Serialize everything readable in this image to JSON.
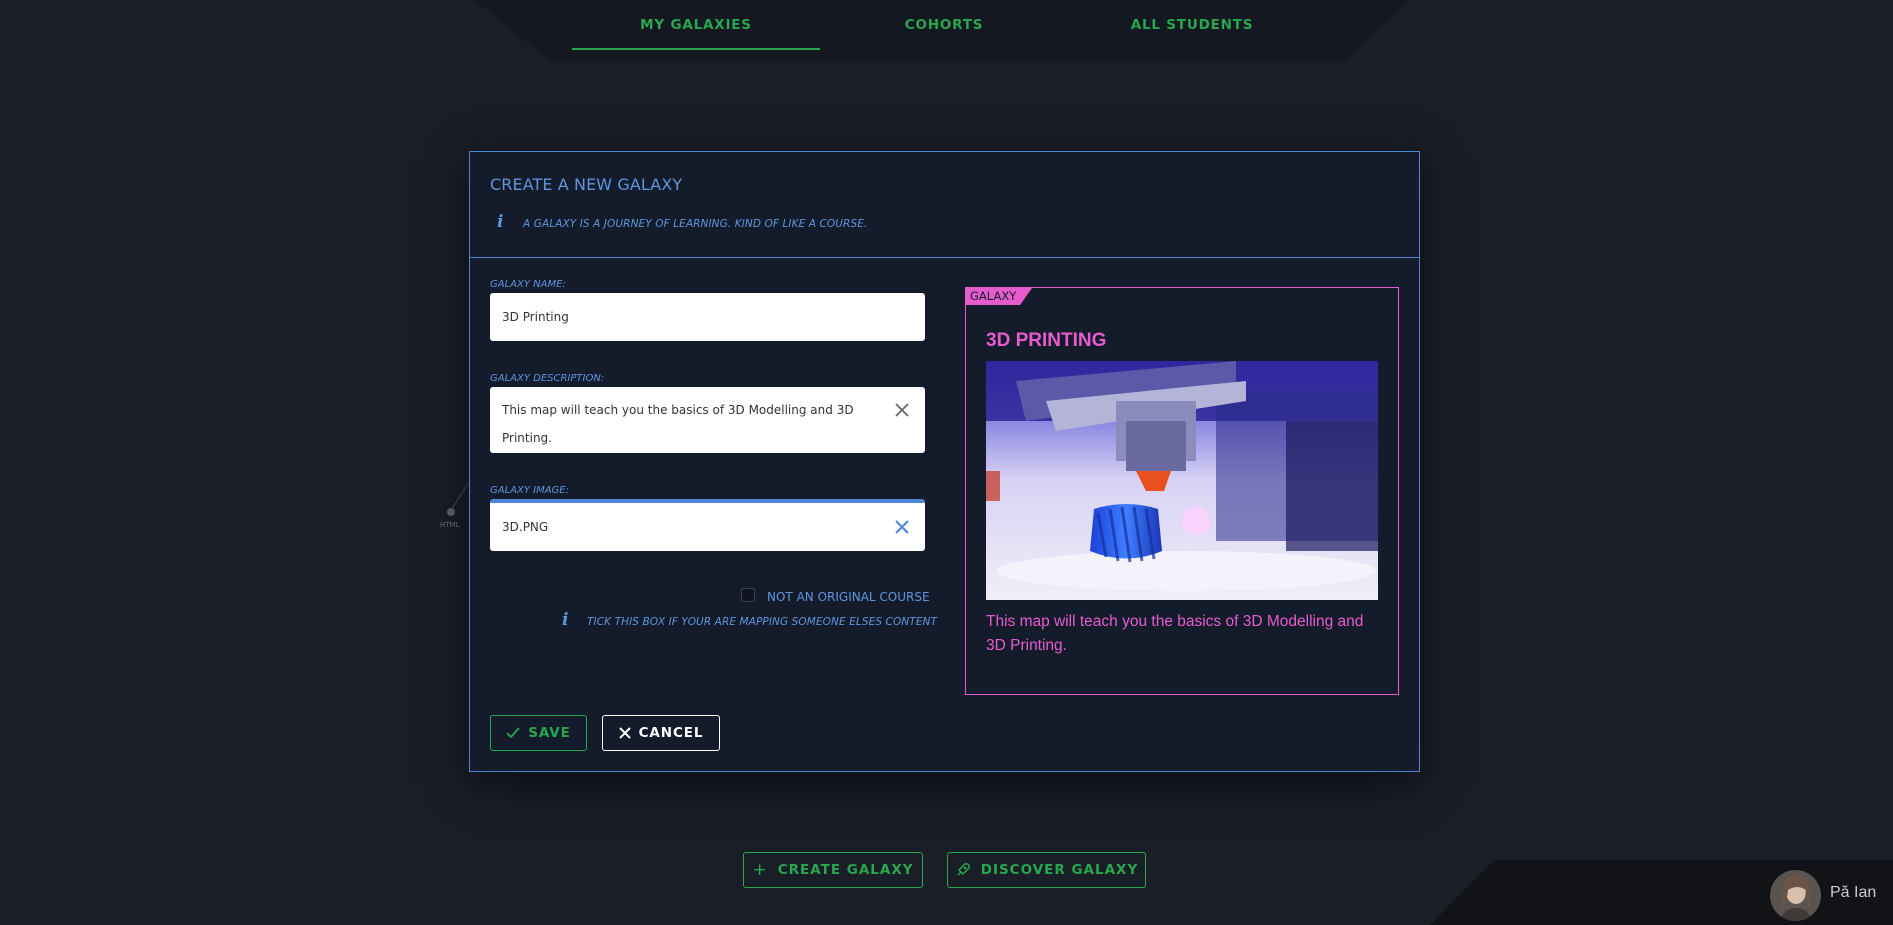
{
  "nav": {
    "tabs": [
      {
        "label": "MY GALAXIES",
        "active": true
      },
      {
        "label": "COHORTS",
        "active": false
      },
      {
        "label": "ALL STUDENTS",
        "active": false
      }
    ]
  },
  "background_node": {
    "label": "HTML"
  },
  "dialog": {
    "title": "CREATE A NEW GALAXY",
    "subtitle": "A GALAXY IS A JOURNEY OF LEARNING. KIND OF LIKE A COURSE.",
    "name": {
      "label": "GALAXY NAME:",
      "value": "3D Printing"
    },
    "description": {
      "label": "GALAXY DESCRIPTION:",
      "value_line1": "This map will teach you the basics of 3D Modelling and 3D",
      "value_line2": "Printing."
    },
    "image": {
      "label": "GALAXY IMAGE:",
      "value": "3D.PNG"
    },
    "not_original": {
      "label": "NOT AN ORIGINAL COURSE",
      "checked": false,
      "hint": "TICK THIS BOX IF YOUR ARE MAPPING SOMEONE ELSES CONTENT"
    },
    "save_label": "SAVE",
    "cancel_label": "CANCEL"
  },
  "preview": {
    "tag": "GALAXY",
    "title": "3D PRINTING",
    "image_alt": "3d-printer-photo",
    "description": "This map will teach you the basics of 3D Modelling and 3D Printing."
  },
  "footer": {
    "create_label": "CREATE GALAXY",
    "discover_label": "DISCOVER GALAXY"
  },
  "user": {
    "name": "Pă Ian"
  },
  "colors": {
    "accent_green": "#27a84f",
    "accent_blue": "#5e96dc",
    "accent_pink": "#e65ccf",
    "background": "#1a1e27",
    "dialog_bg": "#141b2b"
  }
}
